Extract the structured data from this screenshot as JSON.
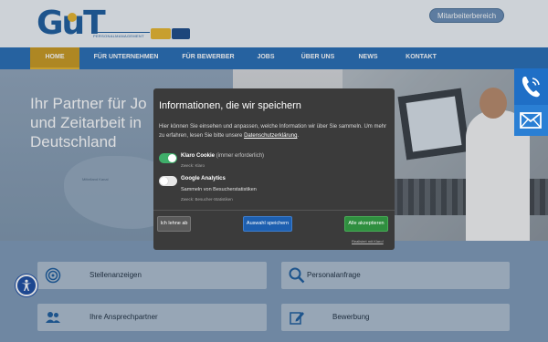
{
  "header": {
    "logo_text": "GuT",
    "logo_subtitle": "PERSONALMANAGEMENT",
    "staff_button": "Mitarbeiterbereich"
  },
  "nav": {
    "items": [
      {
        "label": "HOME",
        "active": true
      },
      {
        "label": "FÜR UNTERNEHMEN",
        "active": false
      },
      {
        "label": "FÜR BEWERBER",
        "active": false
      },
      {
        "label": "JOBS",
        "active": false
      },
      {
        "label": "ÜBER UNS",
        "active": false
      },
      {
        "label": "NEWS",
        "active": false
      },
      {
        "label": "KONTAKT",
        "active": false
      }
    ]
  },
  "hero": {
    "title_line1": "Ihr Partner für Jo",
    "title_line2": "und Zeitarbeit in",
    "title_line3": "Deutschland",
    "map_label": "Mittelland Kanal"
  },
  "side_contact": {
    "phone_icon": "phone-icon",
    "mail_icon": "mail-icon"
  },
  "tiles": [
    {
      "label": "Stellenanzeigen",
      "icon": "target-icon"
    },
    {
      "label": "Personalanfrage",
      "icon": "search-icon"
    },
    {
      "label": "Ihre Ansprechpartner",
      "icon": "people-icon"
    },
    {
      "label": "Bewerbung",
      "icon": "edit-icon"
    }
  ],
  "consent": {
    "title": "Informationen, die wir speichern",
    "description": "Hier können Sie einsehen und anpassen, welche Information wir über Sie sammeln. Um mehr zu erfahren, lesen Sie bitte unsere ",
    "privacy_link": "Datenschutzerklärung",
    "description_end": ".",
    "services": [
      {
        "name": "Klaro Cookie",
        "note": "(immer erforderlich)",
        "description": "",
        "purpose": "Zweck: Klaro",
        "enabled": true
      },
      {
        "name": "Google Analytics",
        "note": "",
        "description": "Sammeln von Besucherstatistiken",
        "purpose": "Zweck: Besucher-Statistiken",
        "enabled": false
      }
    ],
    "decline_button": "Ich lehne ab",
    "save_button": "Auswahl speichern",
    "accept_button": "Alle akzeptieren",
    "powered_by": "Realisiert mit Klaro!"
  },
  "colors": {
    "nav_bg": "#2a6fb5",
    "nav_active": "#c99a23",
    "brand_blue": "#1f5e9e",
    "brand_yellow": "#e8b730",
    "toggle_on": "#3fae6a",
    "modal_bg": "#3b3b3b"
  }
}
